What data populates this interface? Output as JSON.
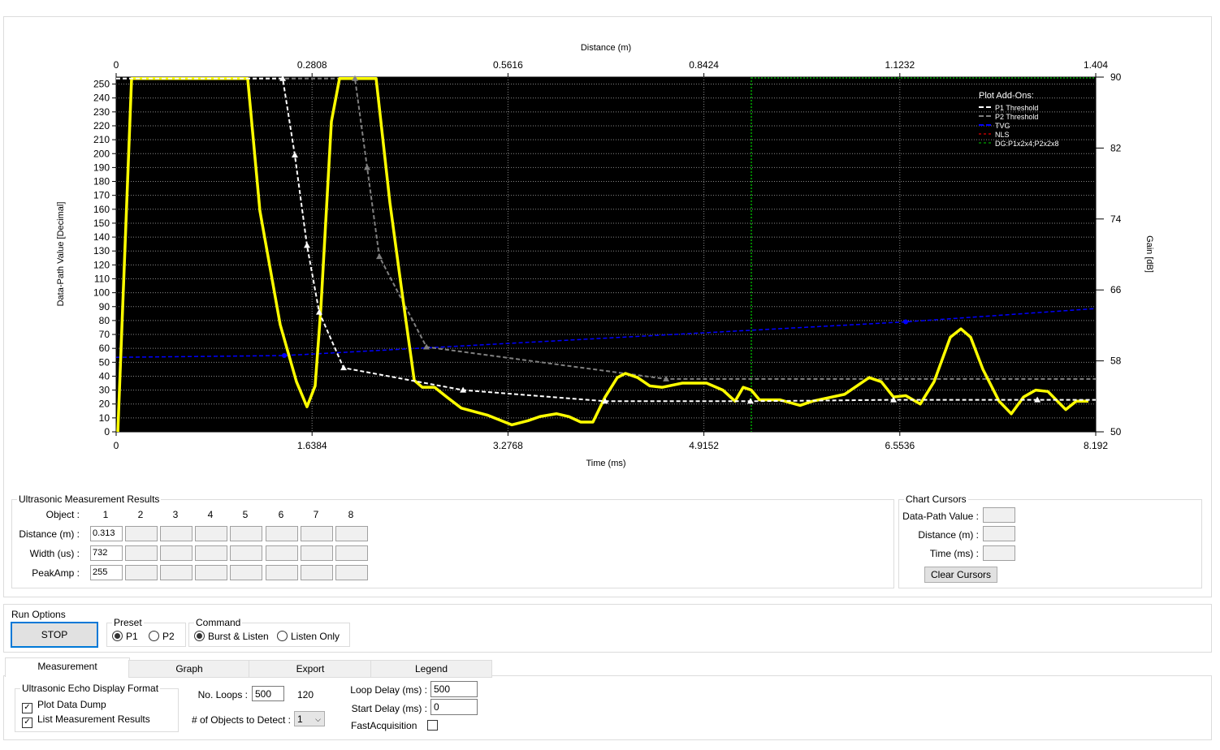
{
  "chart_data": {
    "type": "line",
    "xlabel_top": "Distance (m)",
    "xlabel_bottom": "Time (ms)",
    "ylabel_left": "Data-Path Value [Decimal]",
    "ylabel_right": "Gain [dB]",
    "xlim_time": [
      0,
      8.192
    ],
    "xticks_time": [
      "0",
      "1.6384",
      "3.2768",
      "4.9152",
      "6.5536",
      "8.192"
    ],
    "xticks_distance": [
      "0",
      "0.2808",
      "0.5616",
      "0.8424",
      "1.1232",
      "1.404"
    ],
    "ylim_left": [
      0,
      255
    ],
    "yticks_left": [
      0,
      10,
      20,
      30,
      40,
      50,
      60,
      70,
      80,
      90,
      100,
      110,
      120,
      130,
      140,
      150,
      160,
      170,
      180,
      190,
      200,
      210,
      220,
      230,
      240,
      250
    ],
    "ylim_right": [
      50,
      90
    ],
    "yticks_right": [
      50,
      58,
      66,
      74,
      82,
      90
    ],
    "grid": true,
    "background": "#000000",
    "legend": {
      "title": "Plot Add-Ons:",
      "placement": "top-right",
      "entries": [
        {
          "name": "P1 Threshold",
          "color": "#ffffff"
        },
        {
          "name": "P2 Threshold",
          "color": "#808080"
        },
        {
          "name": "TVG",
          "color": "#0000ff"
        },
        {
          "name": "NLS",
          "color": "#8b0000"
        },
        {
          "name": "DG:P1x2x4;P2x2x8",
          "color": "#006400"
        }
      ]
    },
    "echo": {
      "color": "#ffff00",
      "points": [
        [
          0.014,
          0
        ],
        [
          0.129,
          254
        ],
        [
          1.1,
          254
        ],
        [
          1.202,
          159
        ],
        [
          1.372,
          77
        ],
        [
          1.508,
          36
        ],
        [
          1.596,
          18
        ],
        [
          1.664,
          33
        ],
        [
          1.712,
          89
        ],
        [
          1.8,
          223
        ],
        [
          1.868,
          254
        ],
        [
          2.174,
          254
        ],
        [
          2.289,
          165
        ],
        [
          2.391,
          100
        ],
        [
          2.493,
          37
        ],
        [
          2.561,
          32
        ],
        [
          2.663,
          32
        ],
        [
          2.765,
          25
        ],
        [
          2.887,
          17
        ],
        [
          3.104,
          12
        ],
        [
          3.308,
          5
        ],
        [
          3.444,
          8
        ],
        [
          3.546,
          11
        ],
        [
          3.682,
          13
        ],
        [
          3.784,
          11
        ],
        [
          3.886,
          7
        ],
        [
          3.987,
          7
        ],
        [
          4.089,
          25
        ],
        [
          4.191,
          39
        ],
        [
          4.259,
          42
        ],
        [
          4.361,
          39
        ],
        [
          4.463,
          33
        ],
        [
          4.565,
          32
        ],
        [
          4.735,
          35
        ],
        [
          4.938,
          35
        ],
        [
          5.074,
          30
        ],
        [
          5.176,
          22
        ],
        [
          5.244,
          32
        ],
        [
          5.312,
          30
        ],
        [
          5.38,
          23
        ],
        [
          5.55,
          23
        ],
        [
          5.72,
          19
        ],
        [
          5.822,
          22
        ],
        [
          6.093,
          27
        ],
        [
          6.297,
          39
        ],
        [
          6.399,
          36
        ],
        [
          6.501,
          25
        ],
        [
          6.603,
          26
        ],
        [
          6.725,
          20
        ],
        [
          6.84,
          36
        ],
        [
          6.976,
          68
        ],
        [
          7.065,
          74
        ],
        [
          7.146,
          68
        ],
        [
          7.248,
          45
        ],
        [
          7.384,
          22
        ],
        [
          7.486,
          13
        ],
        [
          7.588,
          25
        ],
        [
          7.69,
          30
        ],
        [
          7.792,
          29
        ],
        [
          7.941,
          16
        ],
        [
          8.029,
          22
        ],
        [
          8.131,
          22
        ]
      ]
    },
    "p1_threshold": [
      [
        0,
        254
      ],
      [
        1.393,
        254
      ],
      [
        1.494,
        199
      ],
      [
        1.596,
        134
      ],
      [
        1.698,
        86
      ],
      [
        1.902,
        46
      ],
      [
        2.901,
        30
      ],
      [
        4.089,
        22
      ],
      [
        5.305,
        22
      ],
      [
        6.501,
        23
      ],
      [
        7.704,
        23
      ],
      [
        8.192,
        23
      ]
    ],
    "p2_threshold": [
      [
        0,
        254
      ],
      [
        1.997,
        254
      ],
      [
        2.099,
        190
      ],
      [
        2.201,
        126
      ],
      [
        2.595,
        61
      ],
      [
        4.599,
        38
      ],
      [
        8.192,
        38
      ]
    ],
    "tvg_db": [
      [
        0,
        58.4
      ],
      [
        1.406,
        58.6
      ],
      [
        6.603,
        62.4
      ],
      [
        8.192,
        63.9
      ]
    ],
    "dg_marker_time": 5.312
  },
  "results": {
    "title": "Ultrasonic Measurement Results",
    "object_label": "Object :",
    "objects": [
      "1",
      "2",
      "3",
      "4",
      "5",
      "6",
      "7",
      "8"
    ],
    "rows": [
      {
        "label": "Distance (m) :",
        "values": [
          "0.313",
          "",
          "",
          "",
          "",
          "",
          "",
          ""
        ]
      },
      {
        "label": "Width (us) :",
        "values": [
          "732",
          "",
          "",
          "",
          "",
          "",
          "",
          ""
        ]
      },
      {
        "label": "PeakAmp :",
        "values": [
          "255",
          "",
          "",
          "",
          "",
          "",
          "",
          ""
        ]
      }
    ]
  },
  "cursors": {
    "title": "Chart Cursors",
    "labels": [
      "Data-Path Value :",
      "Distance (m) :",
      "Time (ms) :"
    ],
    "clear_label": "Clear Cursors"
  },
  "run": {
    "title": "Run Options",
    "stop_label": "STOP",
    "preset_title": "Preset",
    "preset_options": [
      "P1",
      "P2"
    ],
    "preset_selected": "P1",
    "command_title": "Command",
    "command_options": [
      "Burst & Listen",
      "Listen Only"
    ],
    "command_selected": "Burst & Listen"
  },
  "tabs": [
    "Measurement",
    "Graph",
    "Export",
    "Legend"
  ],
  "measurement": {
    "format_title": "Ultrasonic Echo Display Format",
    "plot_dump": "Plot Data Dump",
    "list_results": "List Measurement Results",
    "loops_label": "No. Loops :",
    "loops_value": "500",
    "loop_count": "120",
    "objects_label": "# of Objects to Detect :",
    "objects_value": "1",
    "loop_delay_label": "Loop Delay (ms) :",
    "loop_delay_value": "500",
    "start_delay_label": "Start Delay (ms) :",
    "start_delay_value": "0",
    "fast_label": "FastAcquisition"
  }
}
